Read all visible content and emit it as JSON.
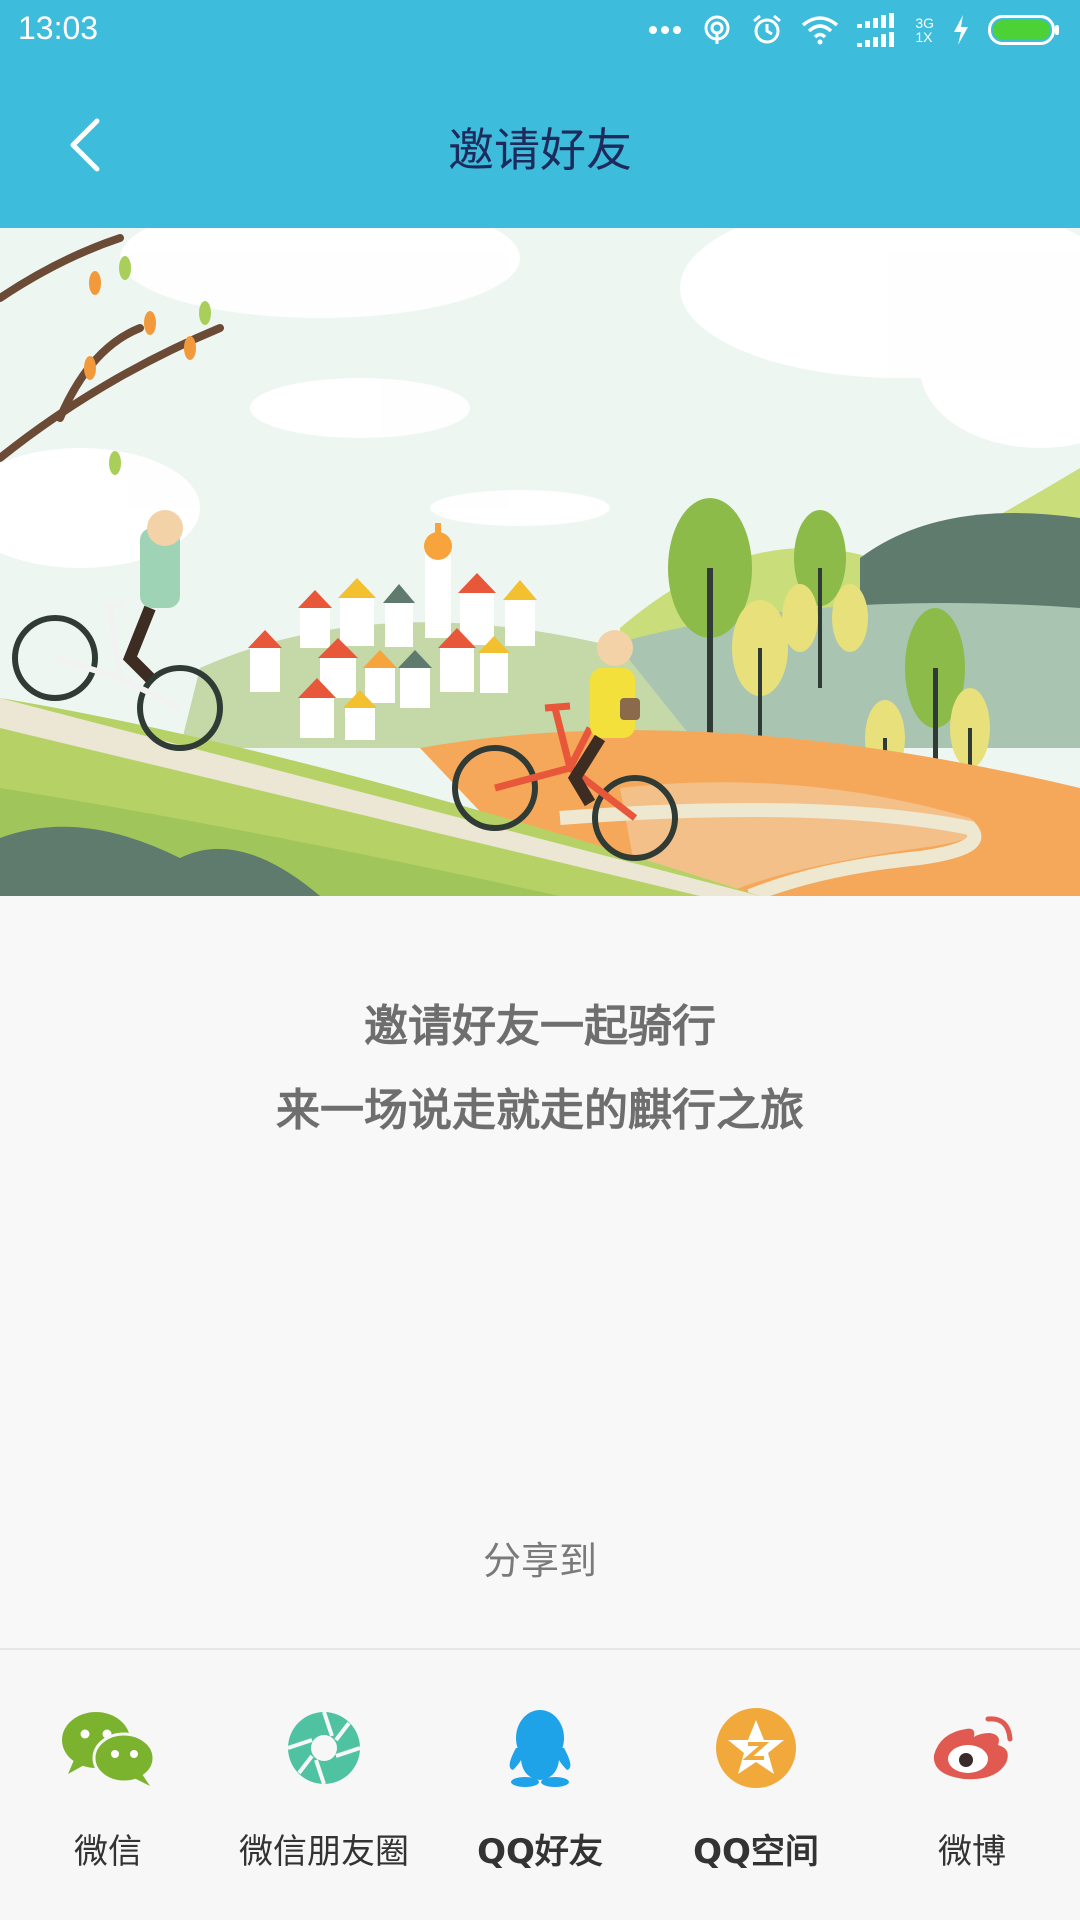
{
  "status_bar": {
    "time": "13:03",
    "network_top": "3G",
    "network_bottom": "1X"
  },
  "header": {
    "title": "邀请好友"
  },
  "invite": {
    "line1": "邀请好友一起骑行",
    "line2": "来一场说走就走的麒行之旅"
  },
  "share": {
    "label": "分享到",
    "items": [
      {
        "label": "微信",
        "icon": "wechat-icon",
        "color": "#7bb32e"
      },
      {
        "label": "微信朋友圈",
        "icon": "moments-icon",
        "color": "#4fc3a1"
      },
      {
        "label": "QQ好友",
        "icon": "qq-icon",
        "color": "#1fa3e8"
      },
      {
        "label": "QQ空间",
        "icon": "qzone-icon",
        "color": "#f0a93a"
      },
      {
        "label": "微博",
        "icon": "weibo-icon",
        "color": "#e05a52"
      }
    ]
  },
  "colors": {
    "header": "#3dbcdc",
    "title": "#1e2a5c",
    "battery": "#4cd137"
  }
}
